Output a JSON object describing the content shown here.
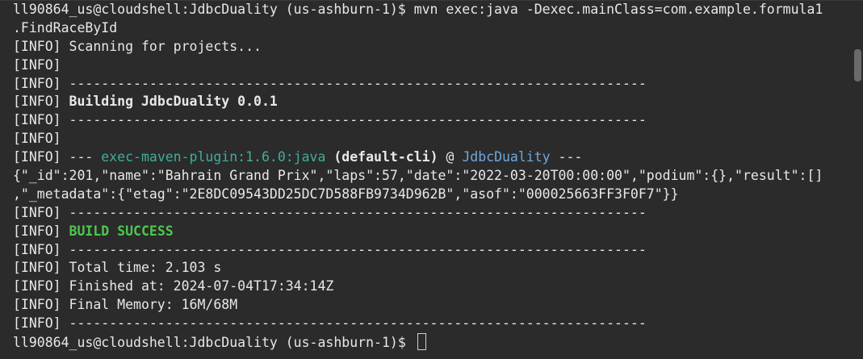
{
  "terminal": {
    "lines": [
      {
        "parts": [
          {
            "text": "ll90864_us@cloudshell:JdbcDuality (us-ashburn-1)$ mvn exec:java -Dexec.mainClass=com.example.formula1",
            "style": "plain"
          }
        ]
      },
      {
        "parts": [
          {
            "text": ".FindRaceById",
            "style": "plain"
          }
        ]
      },
      {
        "parts": [
          {
            "text": "[INFO] Scanning for projects...",
            "style": "plain"
          }
        ]
      },
      {
        "parts": [
          {
            "text": "[INFO]",
            "style": "plain"
          }
        ]
      },
      {
        "parts": [
          {
            "text": "[INFO] ------------------------------------------------------------------------",
            "style": "plain"
          }
        ]
      },
      {
        "parts": [
          {
            "text": "[INFO] ",
            "style": "plain"
          },
          {
            "text": "Building JdbcDuality 0.0.1",
            "style": "bold"
          }
        ]
      },
      {
        "parts": [
          {
            "text": "[INFO] ------------------------------------------------------------------------",
            "style": "plain"
          }
        ]
      },
      {
        "parts": [
          {
            "text": "[INFO]",
            "style": "plain"
          }
        ]
      },
      {
        "parts": [
          {
            "text": "[INFO] --- ",
            "style": "plain"
          },
          {
            "text": "exec-maven-plugin:1.6.0:java",
            "style": "plugin"
          },
          {
            "text": " ",
            "style": "plain"
          },
          {
            "text": "(default-cli)",
            "style": "bold"
          },
          {
            "text": " @ ",
            "style": "plain"
          },
          {
            "text": "JdbcDuality",
            "style": "project"
          },
          {
            "text": " ---",
            "style": "plain"
          }
        ]
      },
      {
        "parts": [
          {
            "text": "{\"_id\":201,\"name\":\"Bahrain Grand Prix\",\"laps\":57,\"date\":\"2022-03-20T00:00:00\",\"podium\":{},\"result\":[]",
            "style": "plain"
          }
        ]
      },
      {
        "parts": [
          {
            "text": ",\"_metadata\":{\"etag\":\"2E8DC09543DD25DC7D588FB9734D962B\",\"asof\":\"000025663FF3F0F7\"}}",
            "style": "plain"
          }
        ]
      },
      {
        "parts": [
          {
            "text": "[INFO] ------------------------------------------------------------------------",
            "style": "plain"
          }
        ]
      },
      {
        "parts": [
          {
            "text": "[INFO] ",
            "style": "plain"
          },
          {
            "text": "BUILD SUCCESS",
            "style": "success"
          }
        ]
      },
      {
        "parts": [
          {
            "text": "[INFO] ------------------------------------------------------------------------",
            "style": "plain"
          }
        ]
      },
      {
        "parts": [
          {
            "text": "[INFO] Total time: 2.103 s",
            "style": "plain"
          }
        ]
      },
      {
        "parts": [
          {
            "text": "[INFO] Finished at: 2024-07-04T17:34:14Z",
            "style": "plain"
          }
        ]
      },
      {
        "parts": [
          {
            "text": "[INFO] Final Memory: 16M/68M",
            "style": "plain"
          }
        ]
      },
      {
        "parts": [
          {
            "text": "[INFO] ------------------------------------------------------------------------",
            "style": "plain"
          }
        ]
      }
    ],
    "prompt": "ll90864_us@cloudshell:JdbcDuality (us-ashburn-1)$ "
  },
  "colors": {
    "background": "#2b2b2b",
    "text": "#e8e8e8",
    "plugin": "#3fae9c",
    "project": "#6fa8dc",
    "success": "#4ec74e"
  }
}
